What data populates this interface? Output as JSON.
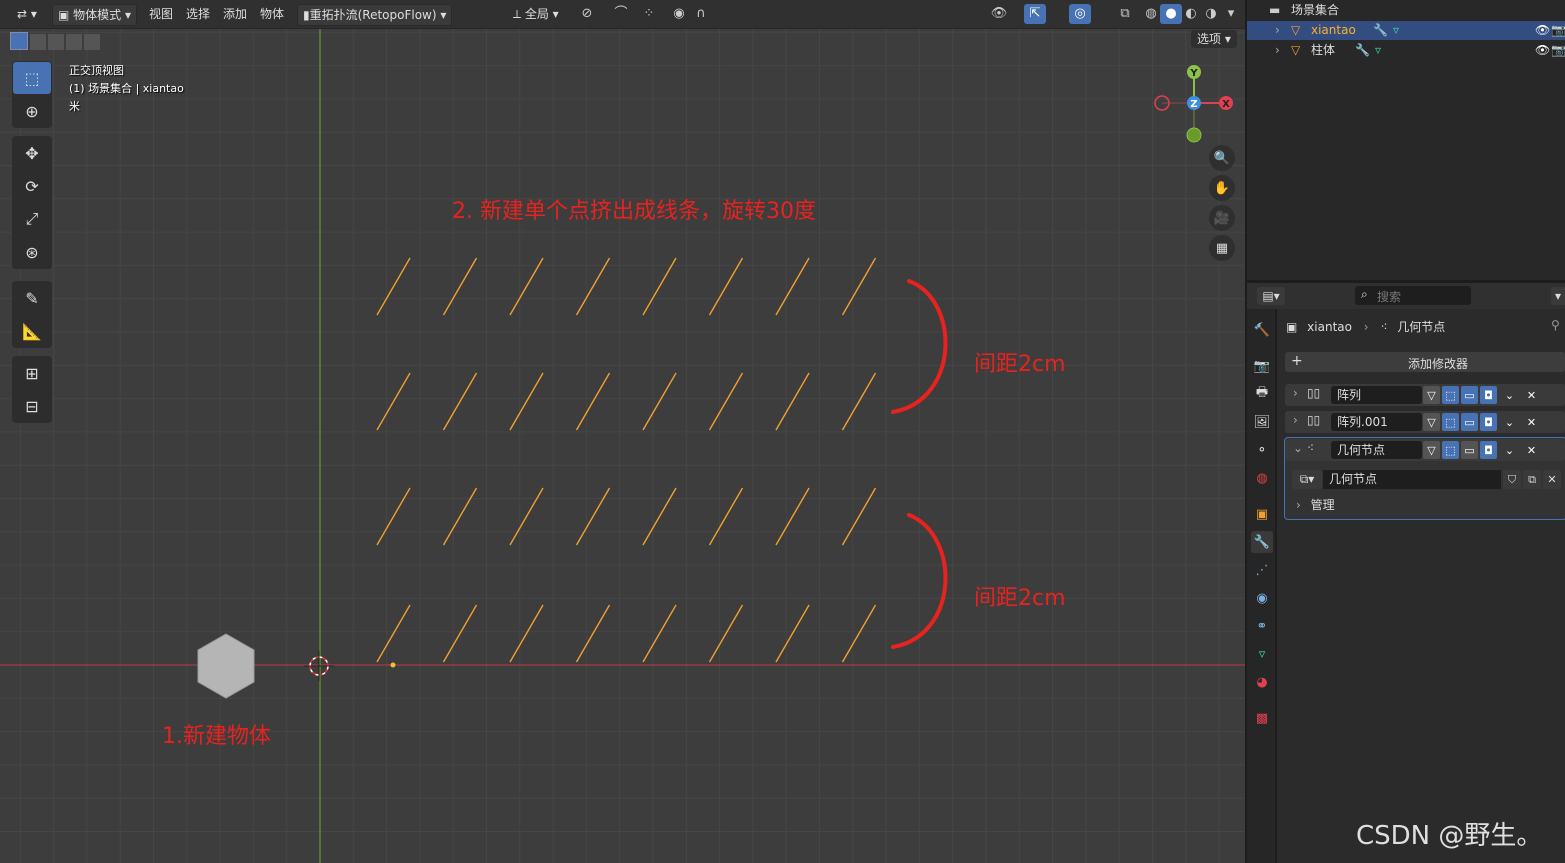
{
  "header": {
    "editor_icon": "⇄",
    "mode": "物体模式",
    "menus": [
      "视图",
      "选择",
      "添加",
      "物体"
    ],
    "retopo": "重拓扑流(RetopoFlow)",
    "transform_orientation": "全局",
    "options_label": "选项"
  },
  "overlay": {
    "view_name": "正交顶视图",
    "collection_info": "(1) 场景集合 | xiantao",
    "unit": "米"
  },
  "gizmo": {
    "x": "X",
    "y": "Y",
    "z": "Z"
  },
  "annotations": {
    "step2": "2. 新建单个点挤出成线条，旋转30度",
    "spacing1": "间距2cm",
    "spacing2": "间距2cm",
    "step1": "1.新建物体"
  },
  "outliner": {
    "root": "场景集合",
    "items": [
      {
        "name": "xiantao",
        "selected": true
      },
      {
        "name": "柱体",
        "selected": false
      }
    ]
  },
  "properties": {
    "search_placeholder": "搜索",
    "breadcrumb_object": "xiantao",
    "breadcrumb_modifier": "几何节点",
    "add_modifier": "添加修改器",
    "modifiers": [
      {
        "name": "阵列",
        "expanded": false
      },
      {
        "name": "阵列.001",
        "expanded": false
      },
      {
        "name": "几何节点",
        "expanded": true
      }
    ],
    "node_group": "几何节点",
    "manage_label": "管理"
  },
  "watermark": "CSDN @野生。",
  "colors": {
    "accent": "#4772b3",
    "annotation": "#e8231f",
    "edge": "#f0a030",
    "x_axis": "#a83a48",
    "y_axis": "#6a9a2a"
  }
}
